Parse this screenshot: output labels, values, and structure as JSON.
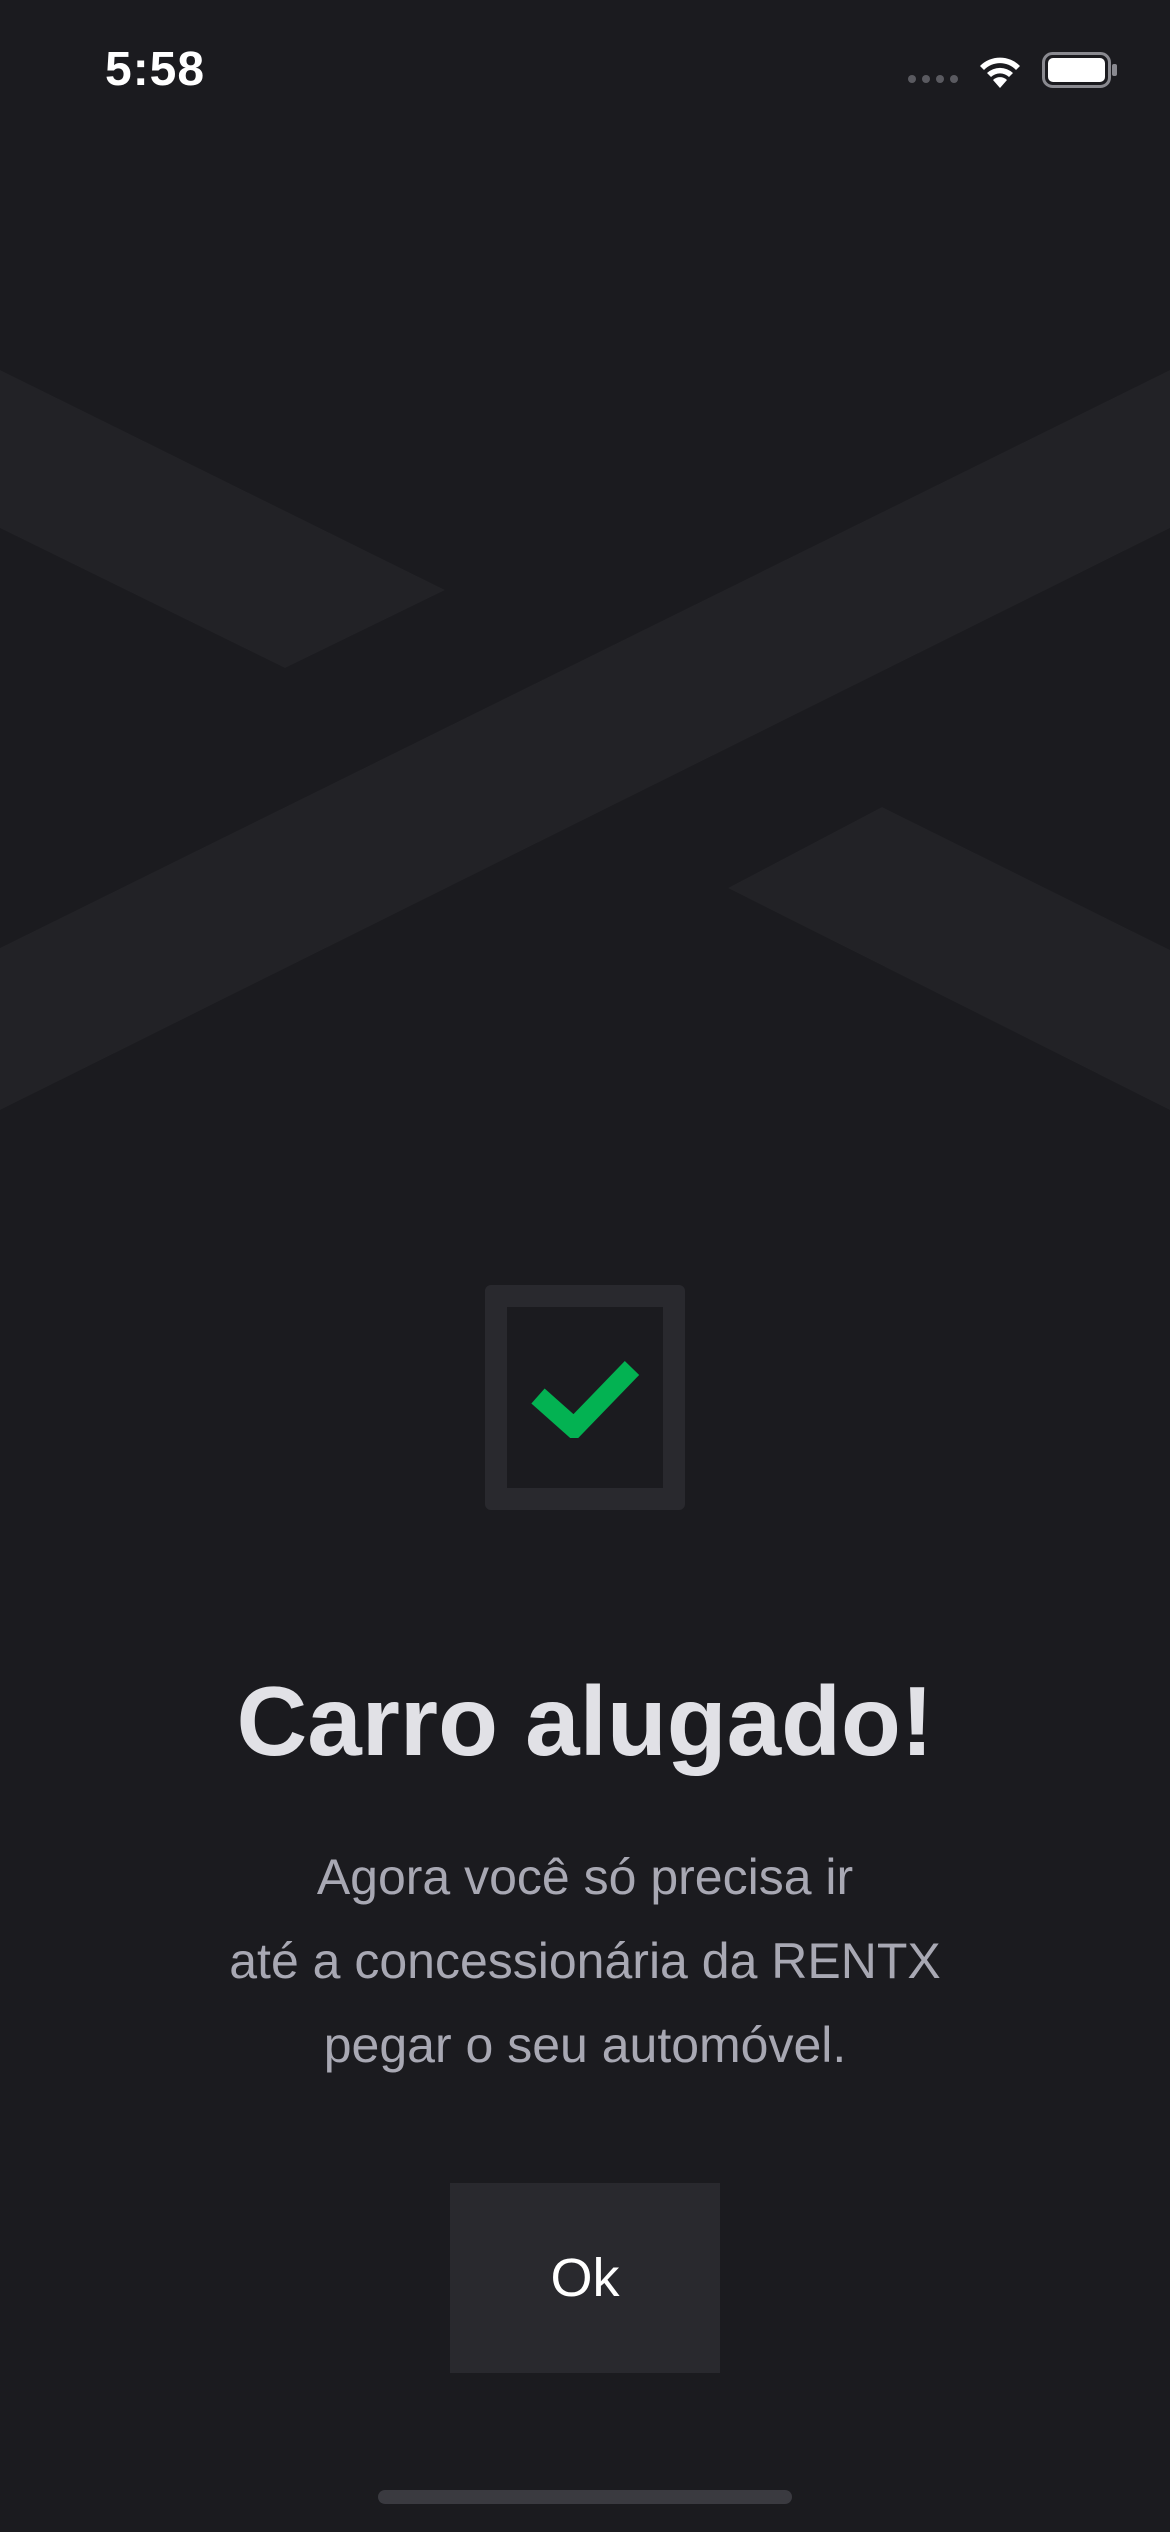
{
  "status_bar": {
    "time": "5:58"
  },
  "screen": {
    "title": "Carro alugado!",
    "message_lines": [
      "Agora você só precisa ir",
      "até a concessionária da RENTX",
      "pegar o seu automóvel."
    ],
    "confirm_button": {
      "label": "Ok"
    }
  },
  "icons": {
    "background": "brand-x-logo-icon",
    "status": [
      "cellular-signal-icon",
      "wifi-icon",
      "battery-icon"
    ],
    "success": "checkmark-icon"
  },
  "colors": {
    "background": "#1b1b1f",
    "logo_shape": "#222226",
    "surface": "#29292e",
    "title": "#e1e1e6",
    "text": "#a8a8b3",
    "success": "#03b252"
  }
}
